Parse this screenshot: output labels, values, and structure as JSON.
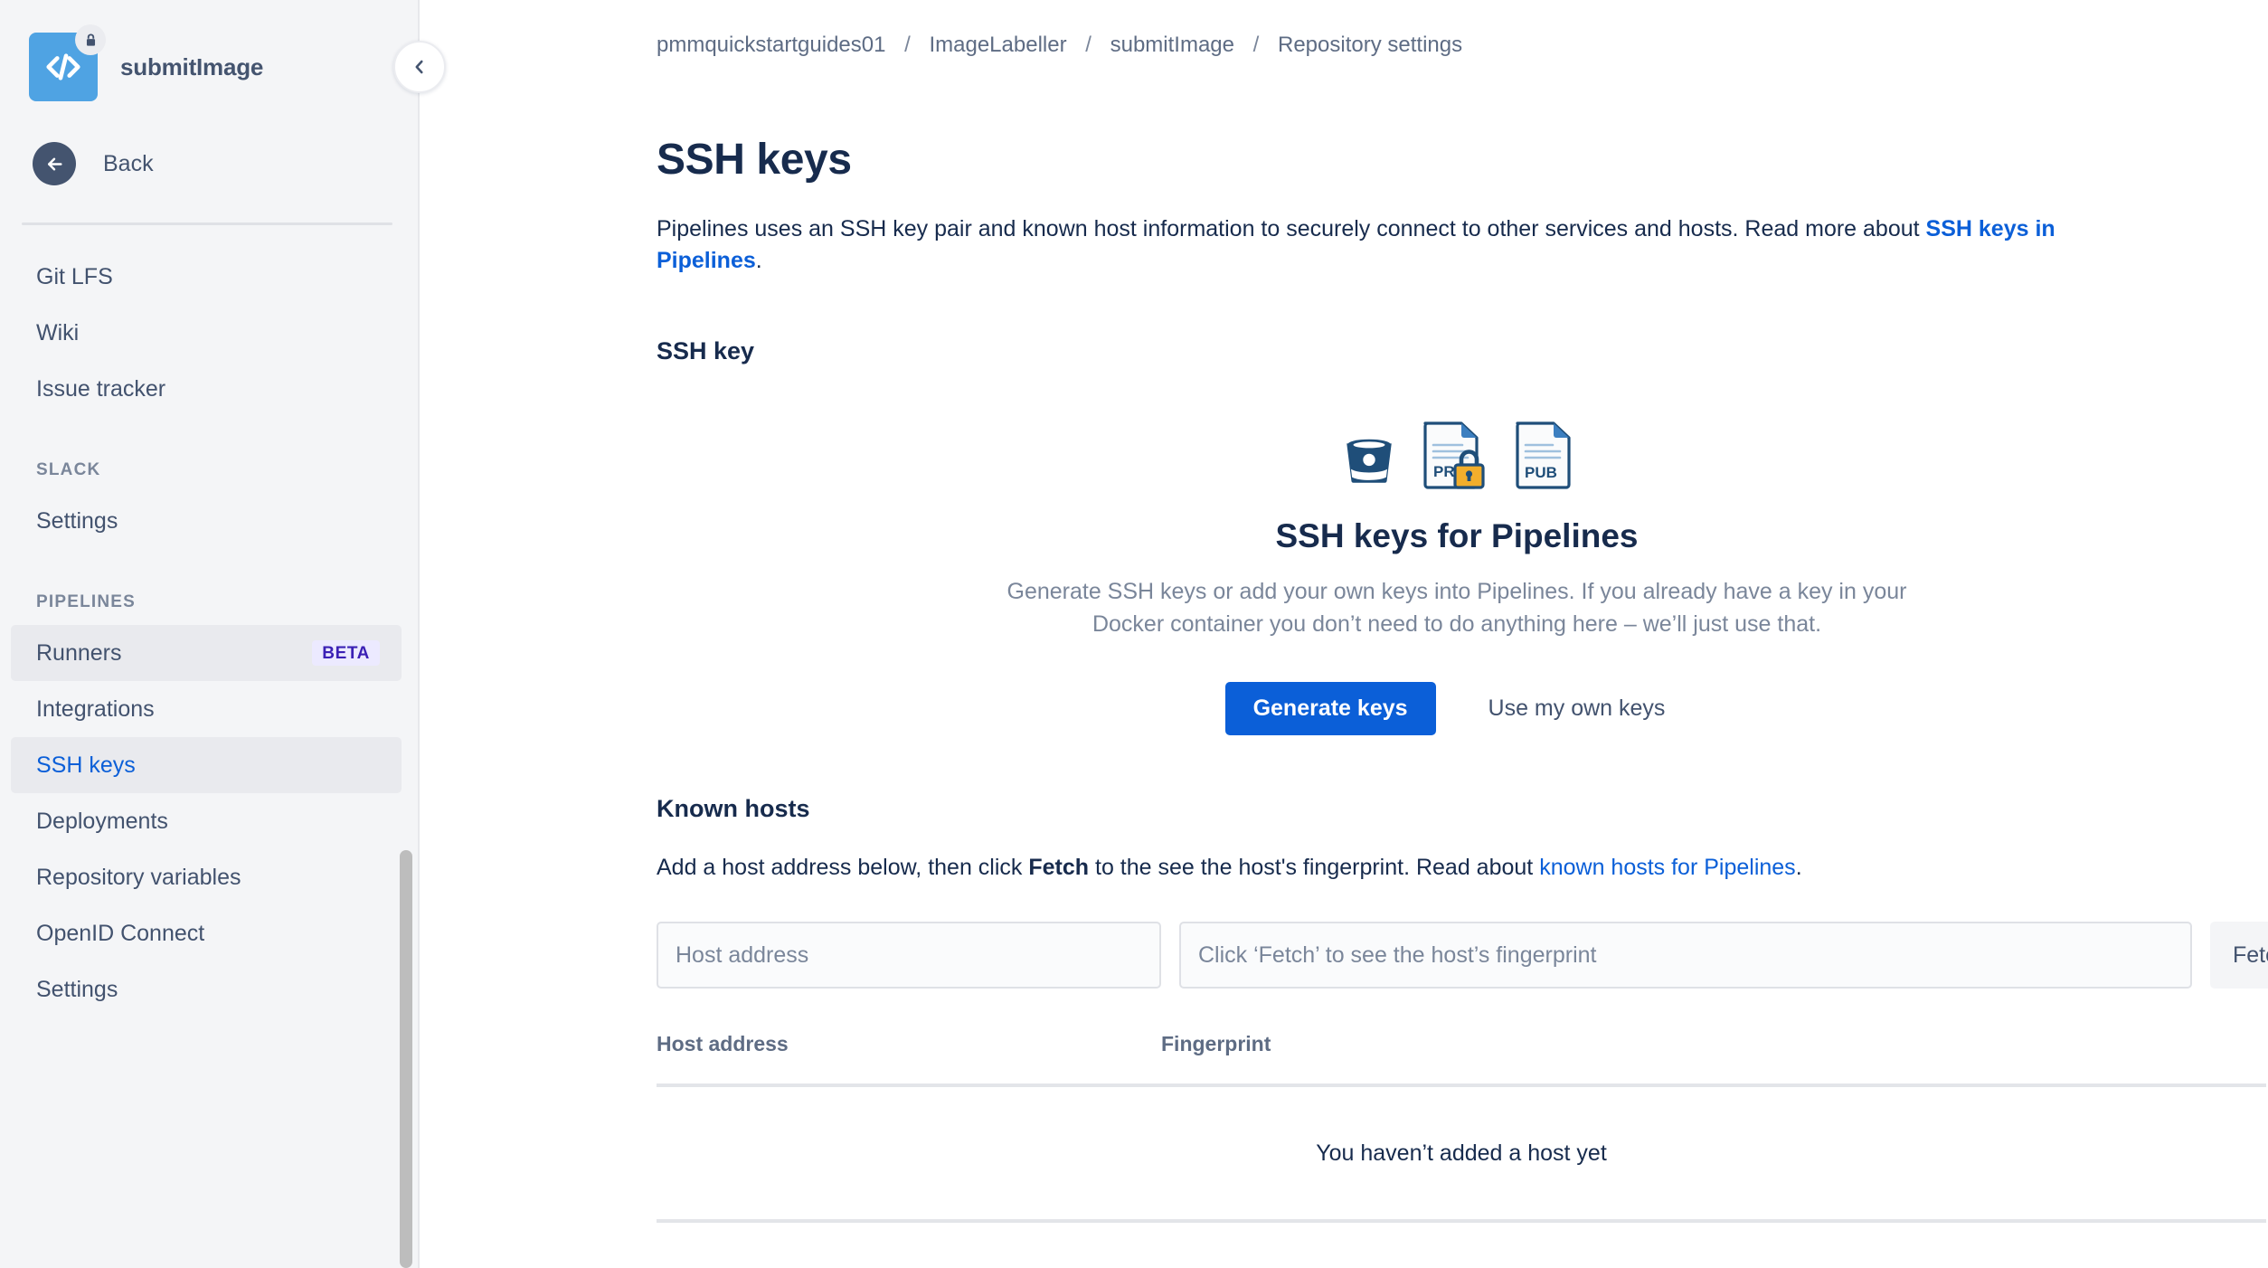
{
  "sidebar": {
    "repo": {
      "name": "submitImage",
      "avatar_icon": "code-brackets-icon",
      "avatar_color": "#4fa3e3",
      "private_icon": "lock-icon"
    },
    "back": {
      "label": "Back",
      "icon": "arrow-left-icon"
    },
    "collapse": {
      "icon": "chevron-left-icon"
    },
    "groups": [
      {
        "heading": null,
        "items": [
          {
            "label": "Git LFS",
            "state": "normal"
          },
          {
            "label": "Wiki",
            "state": "normal"
          },
          {
            "label": "Issue tracker",
            "state": "normal"
          }
        ]
      },
      {
        "heading": "SLACK",
        "items": [
          {
            "label": "Settings",
            "state": "normal"
          }
        ]
      },
      {
        "heading": "PIPELINES",
        "items": [
          {
            "label": "Runners",
            "state": "hover",
            "badge": "BETA"
          },
          {
            "label": "Integrations",
            "state": "normal"
          },
          {
            "label": "SSH keys",
            "state": "selected"
          },
          {
            "label": "Deployments",
            "state": "normal"
          },
          {
            "label": "Repository variables",
            "state": "normal"
          },
          {
            "label": "OpenID Connect",
            "state": "normal"
          },
          {
            "label": "Settings",
            "state": "normal"
          }
        ]
      }
    ]
  },
  "breadcrumb": {
    "items": [
      "pmmquickstartguides01",
      "ImageLabeller",
      "submitImage",
      "Repository settings"
    ],
    "separator": "/"
  },
  "page": {
    "title": "SSH keys",
    "intro_part1": "Pipelines uses an SSH key pair and known host information to securely connect to other services and hosts. Read more about ",
    "intro_link": "SSH keys in Pipelines",
    "intro_part2": "."
  },
  "ssh_key_section": {
    "heading": "SSH key",
    "illustration": {
      "bucket_icon": "bitbucket-bucket-icon",
      "private_key_icon": "private-key-document-icon",
      "private_key_label": "PRI",
      "public_key_icon": "public-key-document-icon",
      "public_key_label": "PUB",
      "lock_icon": "padlock-icon"
    },
    "empty_title": "SSH keys for Pipelines",
    "empty_body": "Generate SSH keys or add your own keys into Pipelines. If you already have a key in your Docker container you don’t need to do anything here – we’ll just use that.",
    "generate_button": "Generate keys",
    "own_keys_button": "Use my own keys"
  },
  "known_hosts": {
    "heading": "Known hosts",
    "desc_part1": "Add a host address below, then click ",
    "desc_bold": "Fetch",
    "desc_part2": " to the see the host's fingerprint. Read about ",
    "desc_link": "known hosts for Pipelines",
    "desc_part3": ".",
    "host_input_placeholder": "Host address",
    "host_input_value": "",
    "fingerprint_input_placeholder": "Click ‘Fetch’ to see the host’s fingerprint",
    "fingerprint_input_value": "",
    "fetch_button": "Fetch",
    "table": {
      "columns": [
        "Host address",
        "Fingerprint"
      ],
      "rows": [],
      "empty_message": "You haven’t added a host yet"
    }
  },
  "colors": {
    "link": "#0b5fd8",
    "primary_button": "#0b5fd8",
    "heading": "#172b4d",
    "muted": "#7a869a",
    "sidebar_bg": "#f4f5f7",
    "beta_badge_bg": "#eceaff",
    "beta_badge_fg": "#3b21b5",
    "avatar": "#4fa3e3"
  }
}
